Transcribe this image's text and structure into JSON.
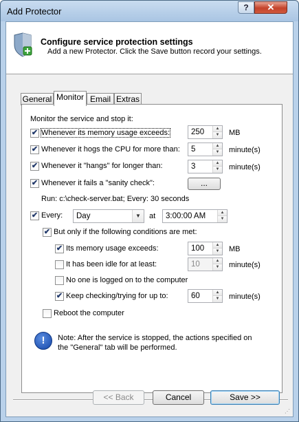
{
  "window": {
    "title": "Add Protector",
    "help_label": "?",
    "close_label": "✕"
  },
  "header": {
    "title": "Configure service protection settings",
    "subtitle": "Add a new Protector. Click the Save button record your settings."
  },
  "tabs": [
    {
      "label": "General",
      "active": false
    },
    {
      "label": "Monitor",
      "active": true
    },
    {
      "label": "Email",
      "active": false
    },
    {
      "label": "Extras",
      "active": false
    }
  ],
  "monitor": {
    "heading": "Monitor the service and stop it:",
    "memory": {
      "label": "Whenever its memory usage exceeds:",
      "checked": true,
      "value": "250",
      "unit": "MB"
    },
    "cpu": {
      "label": "Whenever it hogs the CPU for more than:",
      "checked": true,
      "value": "5",
      "unit": "minute(s)"
    },
    "hangs": {
      "label": "Whenever it \"hangs\" for longer than:",
      "checked": true,
      "value": "3",
      "unit": "minute(s)"
    },
    "sanity": {
      "label": "Whenever it fails a \"sanity check\":",
      "checked": true,
      "button": "..."
    },
    "run_text": "Run: c:\\check-server.bat; Every: 30 seconds",
    "every": {
      "label": "Every:",
      "checked": true,
      "select_value": "Day",
      "at_label": "at",
      "time_value": "3:00:00 AM"
    },
    "conditions": {
      "label": "But only if the following conditions are met:",
      "checked": true,
      "mem": {
        "label": "Its memory usage exceeds:",
        "checked": true,
        "value": "100",
        "unit": "MB"
      },
      "idle": {
        "label": "It has been idle for at least:",
        "checked": false,
        "value": "10",
        "unit": "minute(s)"
      },
      "nologon": {
        "label": "No one is logged on to the computer",
        "checked": false
      },
      "keep": {
        "label": "Keep checking/trying for up to:",
        "checked": true,
        "value": "60",
        "unit": "minute(s)"
      }
    },
    "reboot": {
      "label": "Reboot the computer",
      "checked": false
    },
    "note": "Note: After the service is stopped, the actions specified on the \"General\" tab will be performed."
  },
  "buttons": {
    "back": "<< Back",
    "cancel": "Cancel",
    "save": "Save >>"
  },
  "check_glyph": "✔"
}
